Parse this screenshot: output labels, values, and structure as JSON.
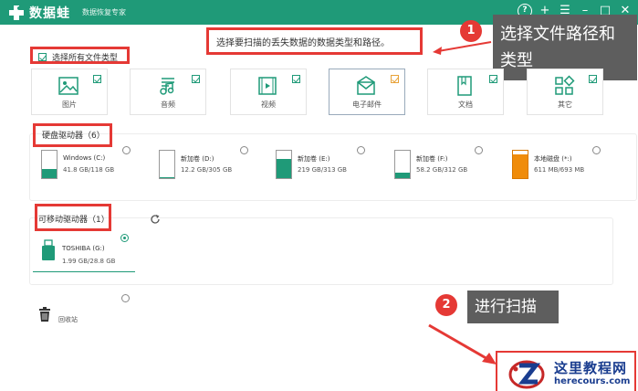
{
  "app": {
    "name": "数据蛙",
    "subtitle": "数据恢复专家",
    "controls": [
      "?",
      "+",
      "☰",
      "–",
      "□",
      "✕"
    ]
  },
  "instructions": {
    "hint": "选择要扫描的丢失数据的数据类型和路径。",
    "select_all_label": "选择所有文件类型"
  },
  "file_types": [
    {
      "label": "图片",
      "icon": "image-icon",
      "checked": true
    },
    {
      "label": "音频",
      "icon": "music-icon",
      "checked": true
    },
    {
      "label": "视频",
      "icon": "video-icon",
      "checked": true
    },
    {
      "label": "电子邮件",
      "icon": "email-icon",
      "checked": true
    },
    {
      "label": "文档",
      "icon": "document-icon",
      "checked": true
    },
    {
      "label": "其它",
      "icon": "other-icon",
      "checked": true
    }
  ],
  "hard_drives": {
    "label": "硬盘驱动器（6）",
    "items": [
      {
        "name": "Windows (C:)",
        "size": "41.8 GB/118 GB",
        "fill": 0.35,
        "color": "#1f9a78"
      },
      {
        "name": "新加卷 (D:)",
        "size": "12.2 GB/305 GB",
        "fill": 0.04,
        "color": "#1f9a78"
      },
      {
        "name": "新加卷 (E:)",
        "size": "219 GB/313 GB",
        "fill": 0.7,
        "color": "#1f9a78"
      },
      {
        "name": "新加卷 (F:)",
        "size": "58.2 GB/312 GB",
        "fill": 0.19,
        "color": "#1f9a78"
      },
      {
        "name": "本地磁盘 (*:)",
        "size": "611 MB/693 MB",
        "fill": 0.88,
        "color": "#f08c0a"
      }
    ]
  },
  "removable_drives": {
    "label": "可移动驱动器（1）",
    "items": [
      {
        "name": "TOSHIBA (G:)",
        "size": "1.99 GB/28.8 GB",
        "selected": true
      }
    ]
  },
  "recycle_bin": {
    "label": "回收站"
  },
  "callouts": [
    {
      "num": "1",
      "text_line1": "选择文件路径和",
      "text_line2": "类型"
    },
    {
      "num": "2",
      "text": "进行扫描"
    }
  ],
  "watermark": {
    "title": "这里教程网",
    "url": "herecours.com"
  }
}
